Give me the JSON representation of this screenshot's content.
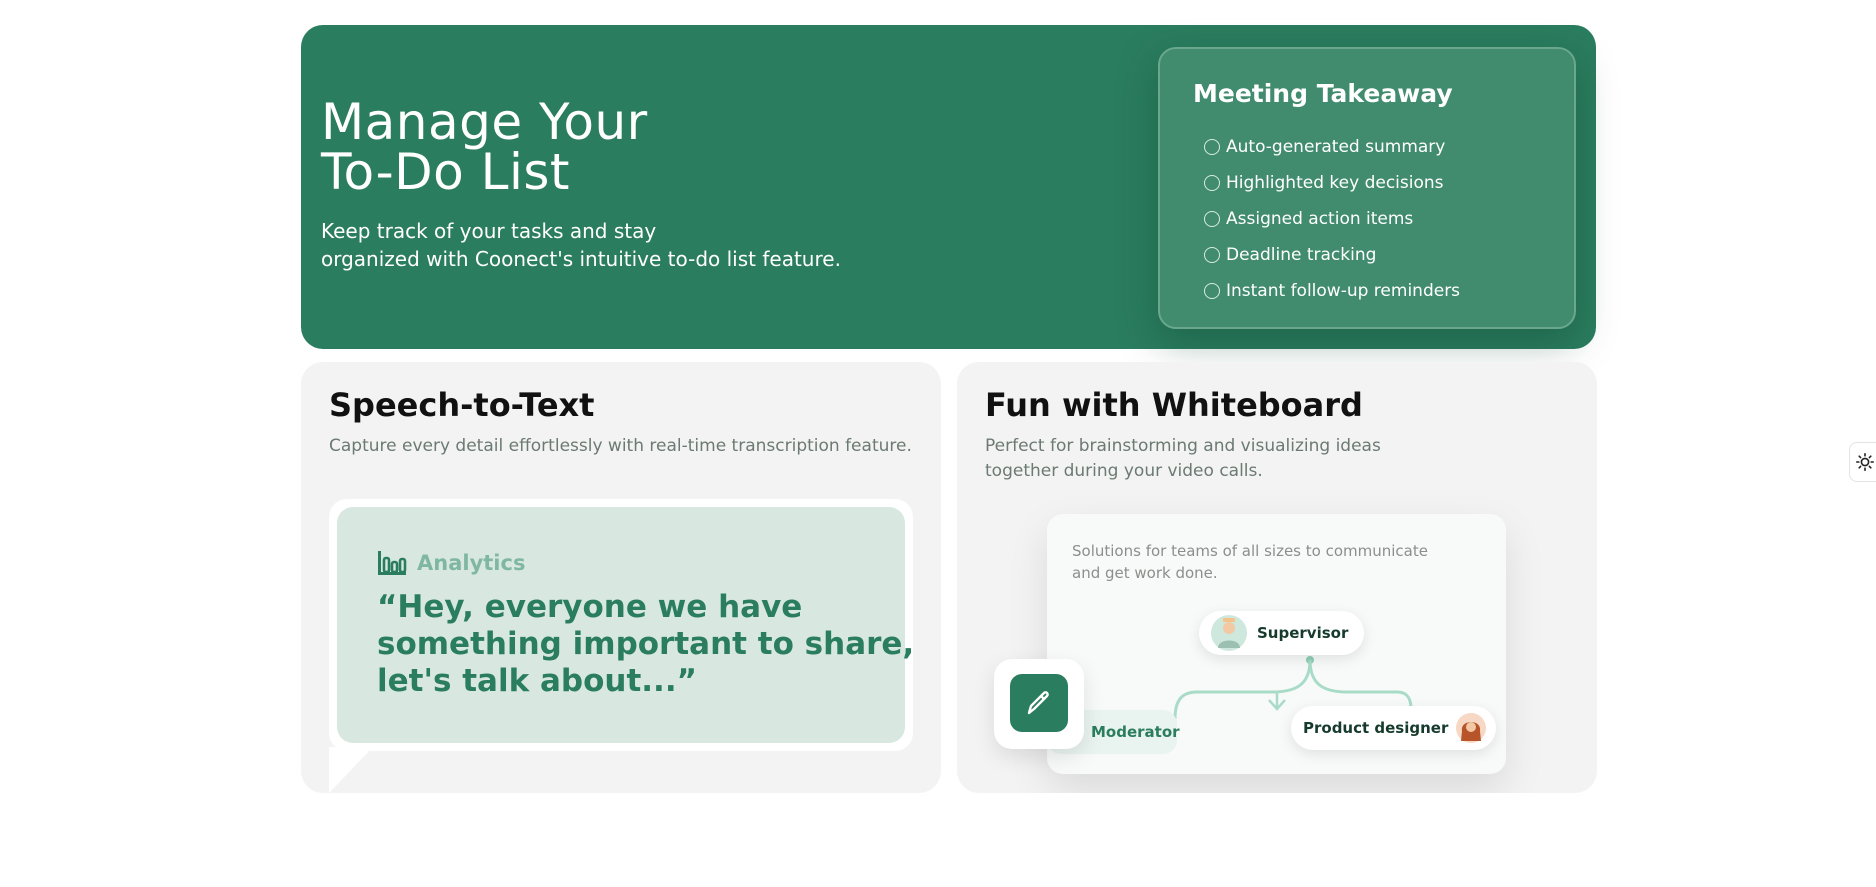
{
  "hero": {
    "title_line1": "Manage Your",
    "title_line2": "To-Do List",
    "subtitle_line1": "Keep track of your tasks and stay",
    "subtitle_line2": "organized with Coonect's intuitive to-do list feature.",
    "background_color": "#2b7d5f"
  },
  "takeaway": {
    "title": "Meeting Takeaway",
    "items": [
      "Auto-generated summary",
      "Highlighted key decisions",
      "Assigned action items",
      "Deadline tracking",
      "Instant follow-up reminders"
    ]
  },
  "speech": {
    "title": "Speech-to-Text",
    "description": "Capture every detail effortlessly with real-time transcription feature.",
    "analytics_label": "Analytics",
    "quote_line1": "“Hey, everyone we have",
    "quote_line2": "something important to share,",
    "quote_line3": "let's talk about...”"
  },
  "whiteboard": {
    "title": "Fun with Whiteboard",
    "description_line1": "Perfect for brainstorming and visualizing ideas",
    "description_line2": "together during your video calls.",
    "panel_text_line1": "Solutions for teams of all sizes to communicate",
    "panel_text_line2": "and get work done.",
    "supervisor_label": "Supervisor",
    "moderator_label": "Moderator",
    "designer_label": "Product designer"
  },
  "icons": {
    "checklist_item": "circle-icon",
    "analytics": "bar-chart-icon",
    "edit": "pencil-icon",
    "theme": "sun-icon"
  },
  "colors": {
    "accent": "#2b7d5f",
    "card_bg": "#f3f3f3",
    "bubble_bg": "#d8e8e1"
  }
}
